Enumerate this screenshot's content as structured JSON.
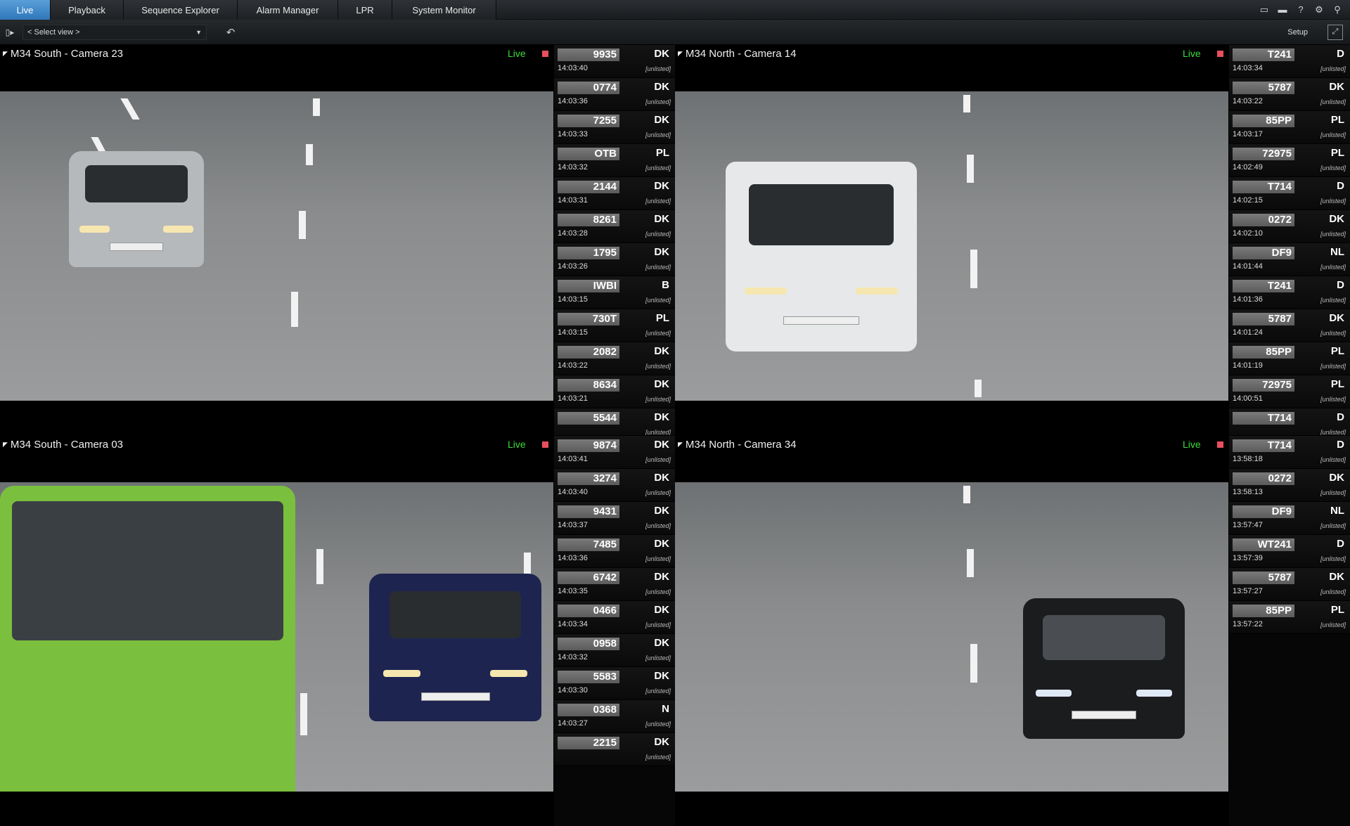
{
  "tabs": [
    {
      "label": "Live",
      "active": true
    },
    {
      "label": "Playback",
      "active": false
    },
    {
      "label": "Sequence Explorer",
      "active": false
    },
    {
      "label": "Alarm Manager",
      "active": false
    },
    {
      "label": "LPR",
      "active": false
    },
    {
      "label": "System Monitor",
      "active": false
    }
  ],
  "toolbar": {
    "select_view": "< Select view >",
    "setup_label": "Setup"
  },
  "live_label": "Live",
  "status_label": "[unlisted]",
  "cameras": [
    {
      "title": "M34 South - Camera 23",
      "plates": [
        {
          "plate": "9935",
          "country": "DK",
          "time": "14:03:40"
        },
        {
          "plate": "0774",
          "country": "DK",
          "time": "14:03:36"
        },
        {
          "plate": "7255",
          "country": "DK",
          "time": "14:03:33"
        },
        {
          "plate": "OTB",
          "country": "PL",
          "time": "14:03:32"
        },
        {
          "plate": "2144",
          "country": "DK",
          "time": "14:03:31"
        },
        {
          "plate": "8261",
          "country": "DK",
          "time": "14:03:28"
        },
        {
          "plate": "1795",
          "country": "DK",
          "time": "14:03:26"
        },
        {
          "plate": "IWBI",
          "country": "B",
          "time": "14:03:15"
        },
        {
          "plate": "730T",
          "country": "PL",
          "time": "14:03:15"
        },
        {
          "plate": "2082",
          "country": "DK",
          "time": "14:03:22"
        },
        {
          "plate": "8634",
          "country": "DK",
          "time": "14:03:21"
        },
        {
          "plate": "5544",
          "country": "DK",
          "time": ""
        }
      ]
    },
    {
      "title": "M34 North - Camera 14",
      "plates": [
        {
          "plate": "T241",
          "country": "D",
          "time": "14:03:34"
        },
        {
          "plate": "5787",
          "country": "DK",
          "time": "14:03:22"
        },
        {
          "plate": "85PP",
          "country": "PL",
          "time": "14:03:17"
        },
        {
          "plate": "72975",
          "country": "PL",
          "time": "14:02:49"
        },
        {
          "plate": "T714",
          "country": "D",
          "time": "14:02:15"
        },
        {
          "plate": "0272",
          "country": "DK",
          "time": "14:02:10"
        },
        {
          "plate": "DF9",
          "country": "NL",
          "time": "14:01:44"
        },
        {
          "plate": "T241",
          "country": "D",
          "time": "14:01:36"
        },
        {
          "plate": "5787",
          "country": "DK",
          "time": "14:01:24"
        },
        {
          "plate": "85PP",
          "country": "PL",
          "time": "14:01:19"
        },
        {
          "plate": "72975",
          "country": "PL",
          "time": "14:00:51"
        },
        {
          "plate": "T714",
          "country": "D",
          "time": ""
        }
      ]
    },
    {
      "title": "M34 South - Camera 03",
      "plates": [
        {
          "plate": "9874",
          "country": "DK",
          "time": "14:03:41"
        },
        {
          "plate": "3274",
          "country": "DK",
          "time": "14:03:40"
        },
        {
          "plate": "9431",
          "country": "DK",
          "time": "14:03:37"
        },
        {
          "plate": "7485",
          "country": "DK",
          "time": "14:03:36"
        },
        {
          "plate": "6742",
          "country": "DK",
          "time": "14:03:35"
        },
        {
          "plate": "0466",
          "country": "DK",
          "time": "14:03:34"
        },
        {
          "plate": "0958",
          "country": "DK",
          "time": "14:03:32"
        },
        {
          "plate": "5583",
          "country": "DK",
          "time": "14:03:30"
        },
        {
          "plate": "0368",
          "country": "N",
          "time": "14:03:27"
        },
        {
          "plate": "2215",
          "country": "DK",
          "time": ""
        }
      ]
    },
    {
      "title": "M34 North - Camera 34",
      "plates": [
        {
          "plate": "T714",
          "country": "D",
          "time": "13:58:18"
        },
        {
          "plate": "0272",
          "country": "DK",
          "time": "13:58:13"
        },
        {
          "plate": "DF9",
          "country": "NL",
          "time": "13:57:47"
        },
        {
          "plate": "WT241",
          "country": "D",
          "time": "13:57:39"
        },
        {
          "plate": "5787",
          "country": "DK",
          "time": "13:57:27"
        },
        {
          "plate": "85PP",
          "country": "PL",
          "time": "13:57:22"
        }
      ]
    }
  ]
}
